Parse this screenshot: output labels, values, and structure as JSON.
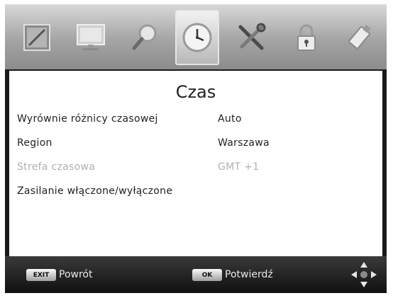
{
  "tabs": [
    {
      "name": "picture",
      "icon": "picture-icon",
      "active": false
    },
    {
      "name": "display",
      "icon": "monitor-icon",
      "active": false
    },
    {
      "name": "search",
      "icon": "search-icon",
      "active": false
    },
    {
      "name": "time",
      "icon": "clock-icon",
      "active": true
    },
    {
      "name": "tools",
      "icon": "tools-icon",
      "active": false
    },
    {
      "name": "lock",
      "icon": "lock-icon",
      "active": false
    },
    {
      "name": "usb",
      "icon": "usb-icon",
      "active": false
    }
  ],
  "panel": {
    "title": "Czas",
    "settings": [
      {
        "label": "Wyrównie różnicy czasowej",
        "value": "Auto",
        "enabled": true
      },
      {
        "label": "Region",
        "value": "Warszawa",
        "enabled": true
      },
      {
        "label": "Strefa czasowa",
        "value": "GMT +1",
        "enabled": false
      },
      {
        "label": "Zasilanie włączone/wyłączone",
        "value": "",
        "enabled": true
      }
    ]
  },
  "footer": {
    "exit_key": "EXIT",
    "exit_label": "Powrót",
    "ok_key": "OK",
    "ok_label": "Potwierdź",
    "nav_icon": "dpad-icon"
  },
  "colors": {
    "panel_bg": "#ffffff",
    "disabled_text": "#b0b0b0",
    "footer_bg": "#1a1a1a"
  }
}
